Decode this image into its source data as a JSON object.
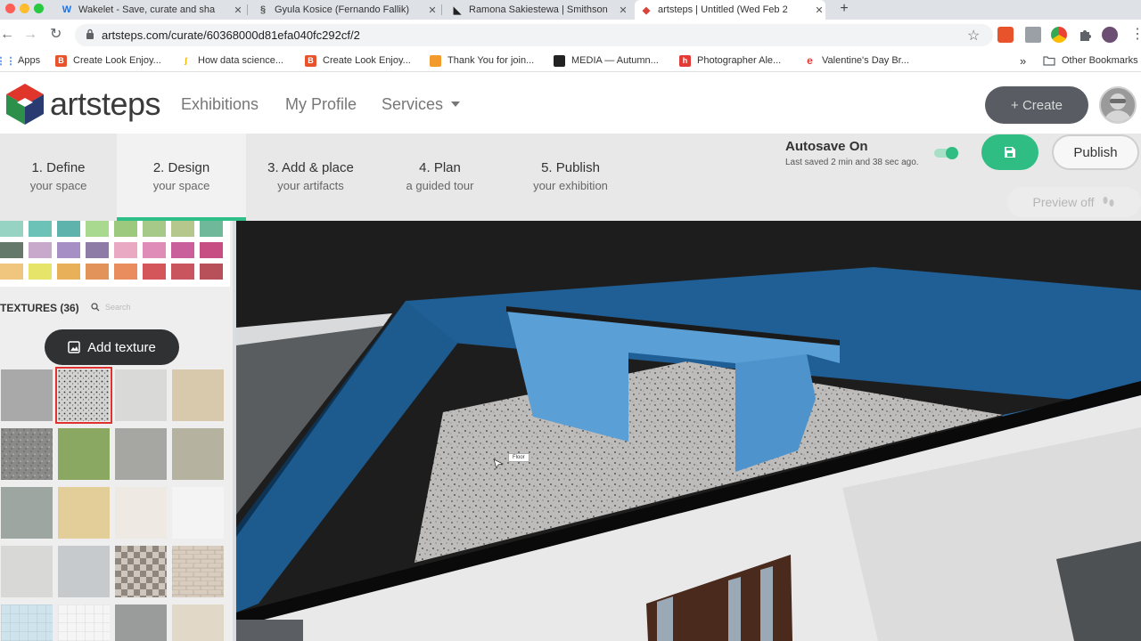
{
  "browser": {
    "tabs": [
      {
        "title": "Wakelet - Save, curate and sha",
        "icon": "W",
        "color": "#1a73e8"
      },
      {
        "title": "Gyula Kosice (Fernando Fallik)",
        "icon": "§",
        "color": "#555555"
      },
      {
        "title": "Ramona Sakiestewa | Smithson",
        "icon": "◣",
        "color": "#222222"
      },
      {
        "title": "artsteps | Untitled (Wed Feb 2",
        "icon": "◆",
        "color": "#d9433b"
      }
    ],
    "url": "artsteps.com/curate/60368000d81efa040fc292cf/2",
    "bookmarks": [
      {
        "label": "Apps",
        "color": "#4285f4"
      },
      {
        "label": "Create Look Enjoy...",
        "color": "#e8532b"
      },
      {
        "label": "How data science...",
        "color": "#f4b400"
      },
      {
        "label": "Create Look Enjoy...",
        "color": "#e8532b"
      },
      {
        "label": "Thank You for join...",
        "color": "#f29b2c"
      },
      {
        "label": "MEDIA — Autumn...",
        "color": "#222222"
      },
      {
        "label": "Photographer Ale...",
        "color": "#e53935"
      },
      {
        "label": "Valentine's Day Br...",
        "color": "#e53935"
      }
    ],
    "bookmarks_more": "»",
    "other_bookmarks": "Other Bookmarks"
  },
  "header": {
    "logo": "artsteps",
    "nav": [
      "Exhibitions",
      "My Profile",
      "Services"
    ],
    "create_label": "+ Create"
  },
  "steps": [
    {
      "title": "1. Define",
      "subtitle": "your space"
    },
    {
      "title": "2. Design",
      "subtitle": "your space"
    },
    {
      "title": "3. Add & place",
      "subtitle": "your artifacts"
    },
    {
      "title": "4. Plan",
      "subtitle": "a guided tour"
    },
    {
      "title": "5. Publish",
      "subtitle": "your exhibition"
    }
  ],
  "active_step": 1,
  "autosave": {
    "label": "Autosave On",
    "last_saved": "Last saved 2 min and 38 sec ago.",
    "enabled": true
  },
  "publish_label": "Publish",
  "preview_label": "Preview off",
  "textures": {
    "header": "TEXTURES (36)",
    "search_placeholder": "Search",
    "add_label": "Add texture",
    "selected_index": 1
  },
  "swatch_colors": [
    [
      "#97d3c3",
      "#6cc2b6",
      "#5fb3ad",
      "#a9d98e",
      "#9cc97e",
      "#a6c989",
      "#b6c78d",
      "#6fb89a"
    ],
    [
      "#65796b",
      "#c8a9cb",
      "#a58fc4",
      "#8f7ca6",
      "#e9a9c3",
      "#df8db8",
      "#c9609c",
      "#c74e82"
    ],
    [
      "#f0c57e",
      "#e6e56a",
      "#e9b05a",
      "#e2935a",
      "#e98c5e",
      "#d5565a",
      "#c9565e",
      "#b8505a"
    ]
  ],
  "viewport": {
    "tooltip": "Floor"
  }
}
